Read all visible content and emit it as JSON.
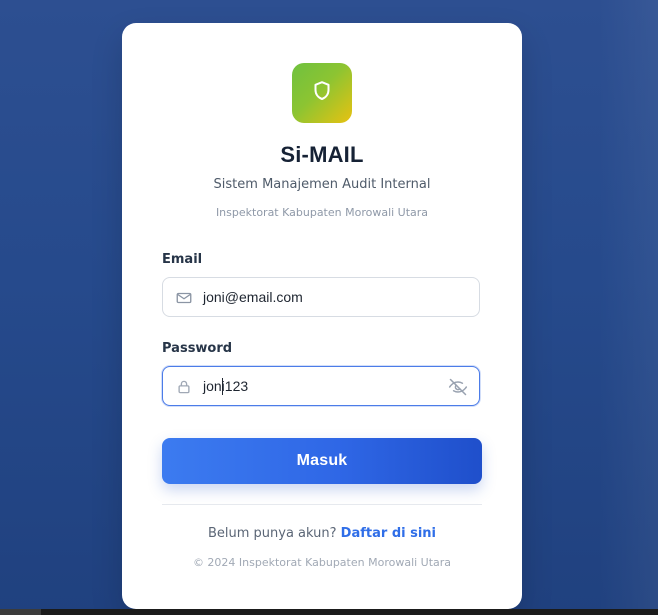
{
  "header": {
    "title": "Si-MAIL",
    "subtitle": "Sistem Manajemen Audit Internal",
    "organization": "Inspektorat Kabupaten Morowali Utara"
  },
  "form": {
    "email_label": "Email",
    "email_value": "joni@email.com",
    "password_label": "Password",
    "password_value": "joni123",
    "submit_label": "Masuk"
  },
  "footer": {
    "signup_prompt": "Belum punya akun?",
    "signup_link": "Daftar di sini",
    "copyright": "© 2024 Inspektorat Kabupaten Morowali Utara"
  },
  "icons": {
    "logo": "shield-icon",
    "email": "mail-icon",
    "password": "lock-icon",
    "password_toggle": "eye-off-icon"
  },
  "colors": {
    "background": "#284b8d",
    "card": "#ffffff",
    "logo_gradient_start": "#6fc13f",
    "logo_gradient_end": "#e8c211",
    "primary_button": "#2f67e6",
    "link": "#2f6ee8",
    "title": "#162235"
  }
}
